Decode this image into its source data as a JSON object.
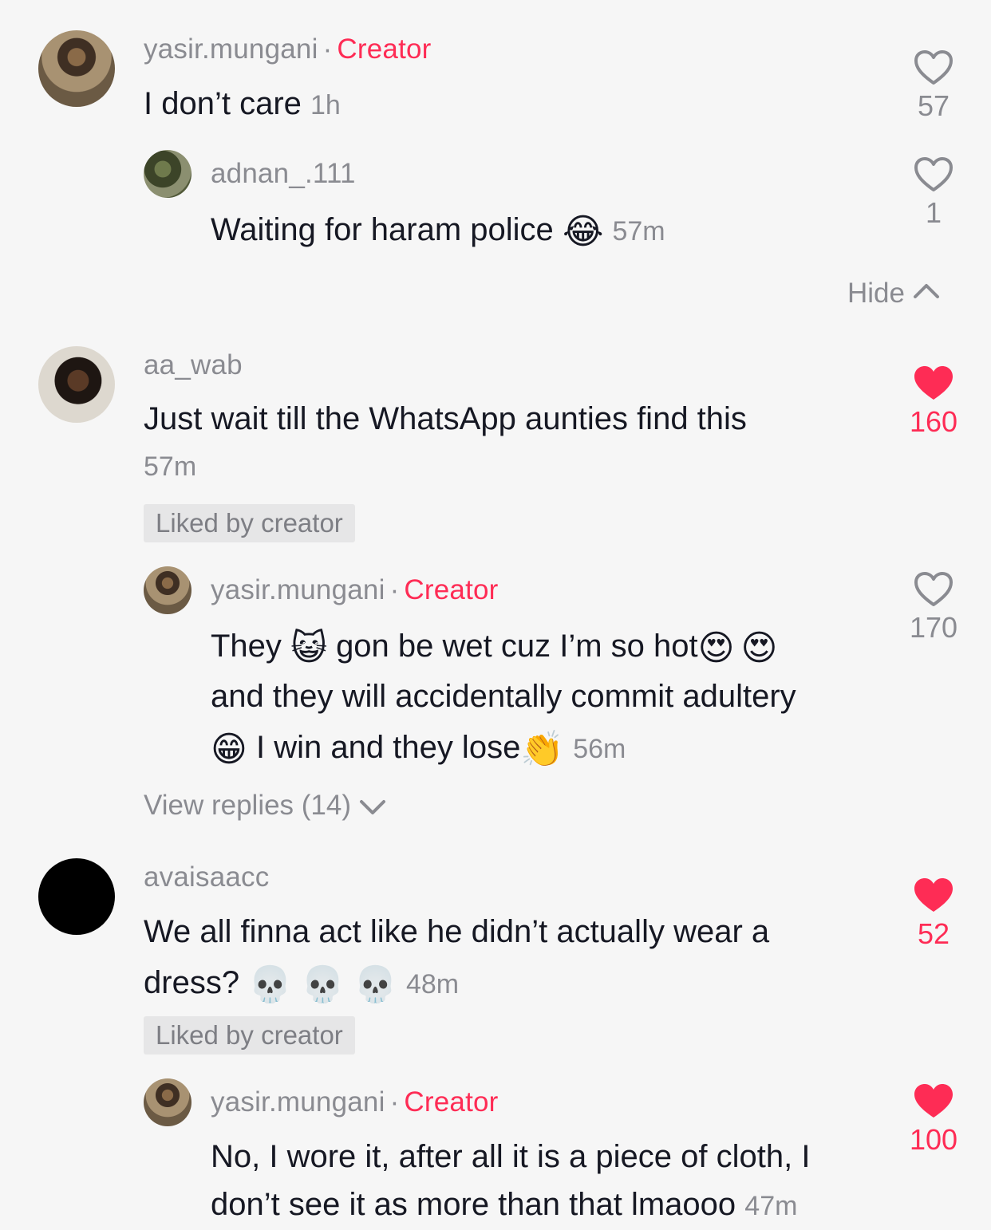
{
  "colors": {
    "accent": "#fe2c55",
    "muted": "#8a8b91",
    "text": "#161823",
    "badge_bg": "#e6e6e7"
  },
  "comments": [
    {
      "username": "yasir.mungani",
      "creator_label": "Creator",
      "text": "I don’t care",
      "time": "1h",
      "likes": "57",
      "liked": false,
      "replies": [
        {
          "username": "adnan_.111",
          "text": "Waiting for haram police",
          "emoji": "face-with-tears-of-joy",
          "emoji_char": "😂",
          "time": "57m",
          "likes": "1",
          "liked": false
        }
      ],
      "hide_label": "Hide"
    },
    {
      "username": "aa_wab",
      "text": "Just wait till the WhatsApp aunties find this",
      "time": "57m",
      "likes": "160",
      "liked": true,
      "badge": "Liked by creator",
      "replies": [
        {
          "username": "yasir.mungani",
          "creator_label": "Creator",
          "text_1": "They",
          "emoji_1": "😺",
          "text_2": "gon be wet cuz I’m so hot",
          "emoji_2": "😍",
          "emoji_3": "😍",
          "text_3": "and they will accidentally commit adultery",
          "emoji_4": "😁",
          "text_4": "I win and they lose",
          "emoji_5": "👏",
          "time": "56m",
          "likes": "170",
          "liked": false
        }
      ],
      "view_replies_label": "View replies (14)"
    },
    {
      "username": "avaisaacc",
      "text_1": "We all finna act like he didn’t actually wear a",
      "text_2": "dress?",
      "emoji": "💀",
      "time": "48m",
      "likes": "52",
      "liked": true,
      "badge": "Liked by creator",
      "replies": [
        {
          "username": "yasir.mungani",
          "creator_label": "Creator",
          "text_1": "No, I wore it, after all it is a piece of cloth, I",
          "text_2": "don’t see it as more than that lmaooo",
          "time": "47m",
          "likes": "100",
          "liked": true
        }
      ]
    }
  ]
}
